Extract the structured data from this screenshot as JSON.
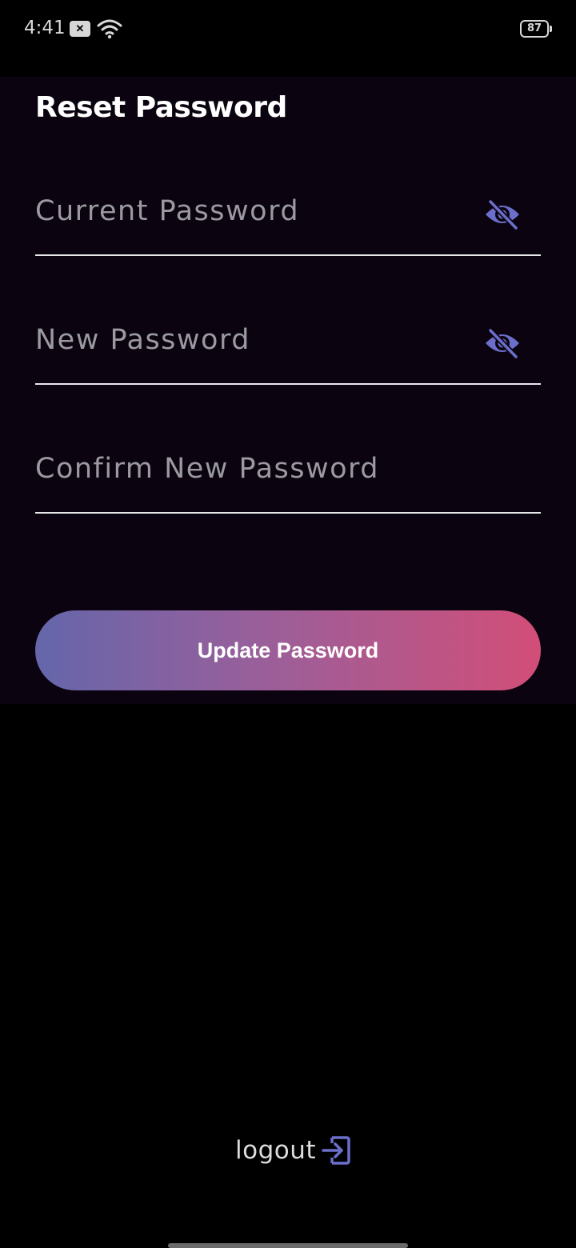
{
  "status_bar": {
    "time": "4:41",
    "battery": "87",
    "icons": [
      "notification-icon",
      "wifi-icon",
      "battery-icon"
    ]
  },
  "page": {
    "title": "Reset Password"
  },
  "form": {
    "current_password": {
      "placeholder": "Current Password",
      "value": "",
      "visibility_icon": "eye-off-icon"
    },
    "new_password": {
      "placeholder": "New Password",
      "value": "",
      "visibility_icon": "eye-off-icon"
    },
    "confirm_password": {
      "placeholder": "Confirm New Password",
      "value": ""
    },
    "submit_label": "Update Password"
  },
  "logout": {
    "label": "logout",
    "icon": "logout-icon"
  },
  "colors": {
    "background": "#000000",
    "card": "#0b030f",
    "accent": "#6b6fcb",
    "gradient_start": "#6466ab",
    "gradient_end": "#d24e78",
    "placeholder": "#9a9aa0"
  }
}
